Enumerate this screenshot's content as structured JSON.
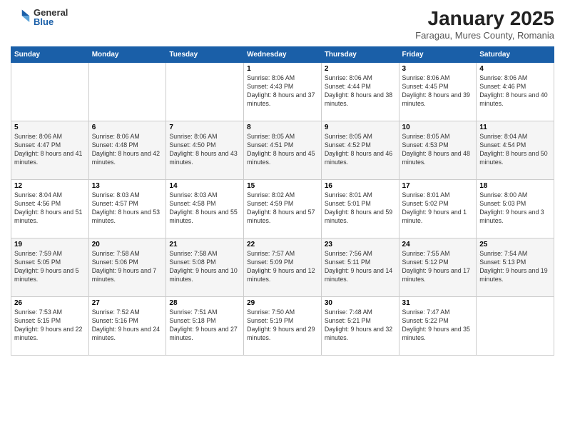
{
  "logo": {
    "general": "General",
    "blue": "Blue"
  },
  "header": {
    "month": "January 2025",
    "location": "Faragau, Mures County, Romania"
  },
  "weekdays": [
    "Sunday",
    "Monday",
    "Tuesday",
    "Wednesday",
    "Thursday",
    "Friday",
    "Saturday"
  ],
  "weeks": [
    [
      {
        "day": "",
        "info": ""
      },
      {
        "day": "",
        "info": ""
      },
      {
        "day": "",
        "info": ""
      },
      {
        "day": "1",
        "info": "Sunrise: 8:06 AM\nSunset: 4:43 PM\nDaylight: 8 hours and 37 minutes."
      },
      {
        "day": "2",
        "info": "Sunrise: 8:06 AM\nSunset: 4:44 PM\nDaylight: 8 hours and 38 minutes."
      },
      {
        "day": "3",
        "info": "Sunrise: 8:06 AM\nSunset: 4:45 PM\nDaylight: 8 hours and 39 minutes."
      },
      {
        "day": "4",
        "info": "Sunrise: 8:06 AM\nSunset: 4:46 PM\nDaylight: 8 hours and 40 minutes."
      }
    ],
    [
      {
        "day": "5",
        "info": "Sunrise: 8:06 AM\nSunset: 4:47 PM\nDaylight: 8 hours and 41 minutes."
      },
      {
        "day": "6",
        "info": "Sunrise: 8:06 AM\nSunset: 4:48 PM\nDaylight: 8 hours and 42 minutes."
      },
      {
        "day": "7",
        "info": "Sunrise: 8:06 AM\nSunset: 4:50 PM\nDaylight: 8 hours and 43 minutes."
      },
      {
        "day": "8",
        "info": "Sunrise: 8:05 AM\nSunset: 4:51 PM\nDaylight: 8 hours and 45 minutes."
      },
      {
        "day": "9",
        "info": "Sunrise: 8:05 AM\nSunset: 4:52 PM\nDaylight: 8 hours and 46 minutes."
      },
      {
        "day": "10",
        "info": "Sunrise: 8:05 AM\nSunset: 4:53 PM\nDaylight: 8 hours and 48 minutes."
      },
      {
        "day": "11",
        "info": "Sunrise: 8:04 AM\nSunset: 4:54 PM\nDaylight: 8 hours and 50 minutes."
      }
    ],
    [
      {
        "day": "12",
        "info": "Sunrise: 8:04 AM\nSunset: 4:56 PM\nDaylight: 8 hours and 51 minutes."
      },
      {
        "day": "13",
        "info": "Sunrise: 8:03 AM\nSunset: 4:57 PM\nDaylight: 8 hours and 53 minutes."
      },
      {
        "day": "14",
        "info": "Sunrise: 8:03 AM\nSunset: 4:58 PM\nDaylight: 8 hours and 55 minutes."
      },
      {
        "day": "15",
        "info": "Sunrise: 8:02 AM\nSunset: 4:59 PM\nDaylight: 8 hours and 57 minutes."
      },
      {
        "day": "16",
        "info": "Sunrise: 8:01 AM\nSunset: 5:01 PM\nDaylight: 8 hours and 59 minutes."
      },
      {
        "day": "17",
        "info": "Sunrise: 8:01 AM\nSunset: 5:02 PM\nDaylight: 9 hours and 1 minute."
      },
      {
        "day": "18",
        "info": "Sunrise: 8:00 AM\nSunset: 5:03 PM\nDaylight: 9 hours and 3 minutes."
      }
    ],
    [
      {
        "day": "19",
        "info": "Sunrise: 7:59 AM\nSunset: 5:05 PM\nDaylight: 9 hours and 5 minutes."
      },
      {
        "day": "20",
        "info": "Sunrise: 7:58 AM\nSunset: 5:06 PM\nDaylight: 9 hours and 7 minutes."
      },
      {
        "day": "21",
        "info": "Sunrise: 7:58 AM\nSunset: 5:08 PM\nDaylight: 9 hours and 10 minutes."
      },
      {
        "day": "22",
        "info": "Sunrise: 7:57 AM\nSunset: 5:09 PM\nDaylight: 9 hours and 12 minutes."
      },
      {
        "day": "23",
        "info": "Sunrise: 7:56 AM\nSunset: 5:11 PM\nDaylight: 9 hours and 14 minutes."
      },
      {
        "day": "24",
        "info": "Sunrise: 7:55 AM\nSunset: 5:12 PM\nDaylight: 9 hours and 17 minutes."
      },
      {
        "day": "25",
        "info": "Sunrise: 7:54 AM\nSunset: 5:13 PM\nDaylight: 9 hours and 19 minutes."
      }
    ],
    [
      {
        "day": "26",
        "info": "Sunrise: 7:53 AM\nSunset: 5:15 PM\nDaylight: 9 hours and 22 minutes."
      },
      {
        "day": "27",
        "info": "Sunrise: 7:52 AM\nSunset: 5:16 PM\nDaylight: 9 hours and 24 minutes."
      },
      {
        "day": "28",
        "info": "Sunrise: 7:51 AM\nSunset: 5:18 PM\nDaylight: 9 hours and 27 minutes."
      },
      {
        "day": "29",
        "info": "Sunrise: 7:50 AM\nSunset: 5:19 PM\nDaylight: 9 hours and 29 minutes."
      },
      {
        "day": "30",
        "info": "Sunrise: 7:48 AM\nSunset: 5:21 PM\nDaylight: 9 hours and 32 minutes."
      },
      {
        "day": "31",
        "info": "Sunrise: 7:47 AM\nSunset: 5:22 PM\nDaylight: 9 hours and 35 minutes."
      },
      {
        "day": "",
        "info": ""
      }
    ]
  ]
}
